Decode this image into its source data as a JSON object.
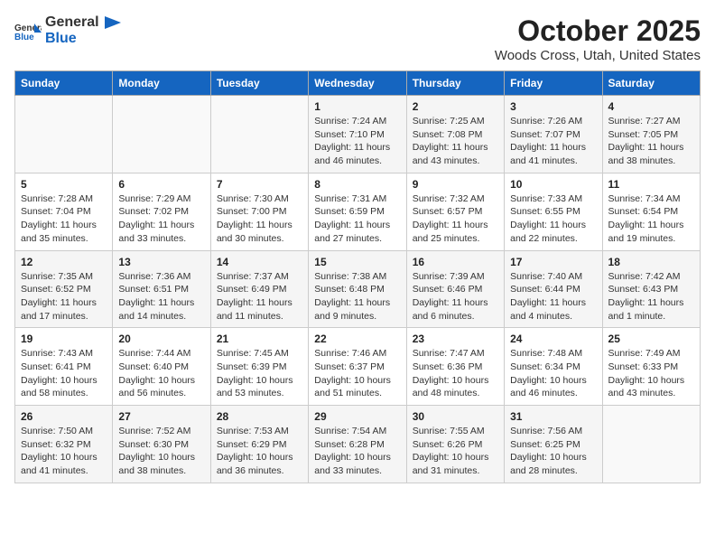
{
  "header": {
    "logo_general": "General",
    "logo_blue": "Blue",
    "month_title": "October 2025",
    "location": "Woods Cross, Utah, United States"
  },
  "weekdays": [
    "Sunday",
    "Monday",
    "Tuesday",
    "Wednesday",
    "Thursday",
    "Friday",
    "Saturday"
  ],
  "weeks": [
    [
      {
        "day": "",
        "info": ""
      },
      {
        "day": "",
        "info": ""
      },
      {
        "day": "",
        "info": ""
      },
      {
        "day": "1",
        "info": "Sunrise: 7:24 AM\nSunset: 7:10 PM\nDaylight: 11 hours and 46 minutes."
      },
      {
        "day": "2",
        "info": "Sunrise: 7:25 AM\nSunset: 7:08 PM\nDaylight: 11 hours and 43 minutes."
      },
      {
        "day": "3",
        "info": "Sunrise: 7:26 AM\nSunset: 7:07 PM\nDaylight: 11 hours and 41 minutes."
      },
      {
        "day": "4",
        "info": "Sunrise: 7:27 AM\nSunset: 7:05 PM\nDaylight: 11 hours and 38 minutes."
      }
    ],
    [
      {
        "day": "5",
        "info": "Sunrise: 7:28 AM\nSunset: 7:04 PM\nDaylight: 11 hours and 35 minutes."
      },
      {
        "day": "6",
        "info": "Sunrise: 7:29 AM\nSunset: 7:02 PM\nDaylight: 11 hours and 33 minutes."
      },
      {
        "day": "7",
        "info": "Sunrise: 7:30 AM\nSunset: 7:00 PM\nDaylight: 11 hours and 30 minutes."
      },
      {
        "day": "8",
        "info": "Sunrise: 7:31 AM\nSunset: 6:59 PM\nDaylight: 11 hours and 27 minutes."
      },
      {
        "day": "9",
        "info": "Sunrise: 7:32 AM\nSunset: 6:57 PM\nDaylight: 11 hours and 25 minutes."
      },
      {
        "day": "10",
        "info": "Sunrise: 7:33 AM\nSunset: 6:55 PM\nDaylight: 11 hours and 22 minutes."
      },
      {
        "day": "11",
        "info": "Sunrise: 7:34 AM\nSunset: 6:54 PM\nDaylight: 11 hours and 19 minutes."
      }
    ],
    [
      {
        "day": "12",
        "info": "Sunrise: 7:35 AM\nSunset: 6:52 PM\nDaylight: 11 hours and 17 minutes."
      },
      {
        "day": "13",
        "info": "Sunrise: 7:36 AM\nSunset: 6:51 PM\nDaylight: 11 hours and 14 minutes."
      },
      {
        "day": "14",
        "info": "Sunrise: 7:37 AM\nSunset: 6:49 PM\nDaylight: 11 hours and 11 minutes."
      },
      {
        "day": "15",
        "info": "Sunrise: 7:38 AM\nSunset: 6:48 PM\nDaylight: 11 hours and 9 minutes."
      },
      {
        "day": "16",
        "info": "Sunrise: 7:39 AM\nSunset: 6:46 PM\nDaylight: 11 hours and 6 minutes."
      },
      {
        "day": "17",
        "info": "Sunrise: 7:40 AM\nSunset: 6:44 PM\nDaylight: 11 hours and 4 minutes."
      },
      {
        "day": "18",
        "info": "Sunrise: 7:42 AM\nSunset: 6:43 PM\nDaylight: 11 hours and 1 minute."
      }
    ],
    [
      {
        "day": "19",
        "info": "Sunrise: 7:43 AM\nSunset: 6:41 PM\nDaylight: 10 hours and 58 minutes."
      },
      {
        "day": "20",
        "info": "Sunrise: 7:44 AM\nSunset: 6:40 PM\nDaylight: 10 hours and 56 minutes."
      },
      {
        "day": "21",
        "info": "Sunrise: 7:45 AM\nSunset: 6:39 PM\nDaylight: 10 hours and 53 minutes."
      },
      {
        "day": "22",
        "info": "Sunrise: 7:46 AM\nSunset: 6:37 PM\nDaylight: 10 hours and 51 minutes."
      },
      {
        "day": "23",
        "info": "Sunrise: 7:47 AM\nSunset: 6:36 PM\nDaylight: 10 hours and 48 minutes."
      },
      {
        "day": "24",
        "info": "Sunrise: 7:48 AM\nSunset: 6:34 PM\nDaylight: 10 hours and 46 minutes."
      },
      {
        "day": "25",
        "info": "Sunrise: 7:49 AM\nSunset: 6:33 PM\nDaylight: 10 hours and 43 minutes."
      }
    ],
    [
      {
        "day": "26",
        "info": "Sunrise: 7:50 AM\nSunset: 6:32 PM\nDaylight: 10 hours and 41 minutes."
      },
      {
        "day": "27",
        "info": "Sunrise: 7:52 AM\nSunset: 6:30 PM\nDaylight: 10 hours and 38 minutes."
      },
      {
        "day": "28",
        "info": "Sunrise: 7:53 AM\nSunset: 6:29 PM\nDaylight: 10 hours and 36 minutes."
      },
      {
        "day": "29",
        "info": "Sunrise: 7:54 AM\nSunset: 6:28 PM\nDaylight: 10 hours and 33 minutes."
      },
      {
        "day": "30",
        "info": "Sunrise: 7:55 AM\nSunset: 6:26 PM\nDaylight: 10 hours and 31 minutes."
      },
      {
        "day": "31",
        "info": "Sunrise: 7:56 AM\nSunset: 6:25 PM\nDaylight: 10 hours and 28 minutes."
      },
      {
        "day": "",
        "info": ""
      }
    ]
  ]
}
